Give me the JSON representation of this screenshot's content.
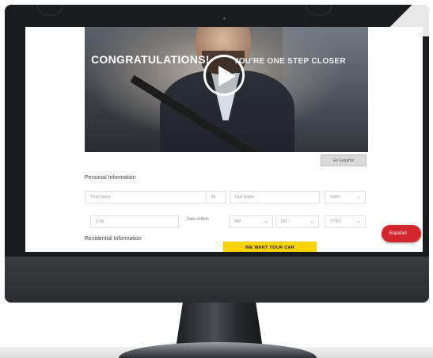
{
  "video": {
    "title_main": "CONGRATULATIONS!",
    "title_rest": "YOU'RE ONE STEP CLOSER"
  },
  "form": {
    "language_button": "En Español",
    "personal_heading": "Personal Information",
    "residential_heading": "Residential Information",
    "first_name_placeholder": "First Name",
    "mi_placeholder": "MI",
    "last_name_placeholder": "Last Name",
    "suffix_value": "Suffix",
    "ssn_placeholder": "SSN",
    "dob_label": "Date of Birth",
    "month_value": "MM",
    "day_value": "DD",
    "year_value": "YYYY",
    "cta_label": "WE WANT YOUR CAR"
  },
  "language_toggle": {
    "label": "Español"
  },
  "colors": {
    "cta_yellow": "#ffd200",
    "espanol_red": "#d2262c",
    "monitor_frame": "#1a1b1e"
  }
}
